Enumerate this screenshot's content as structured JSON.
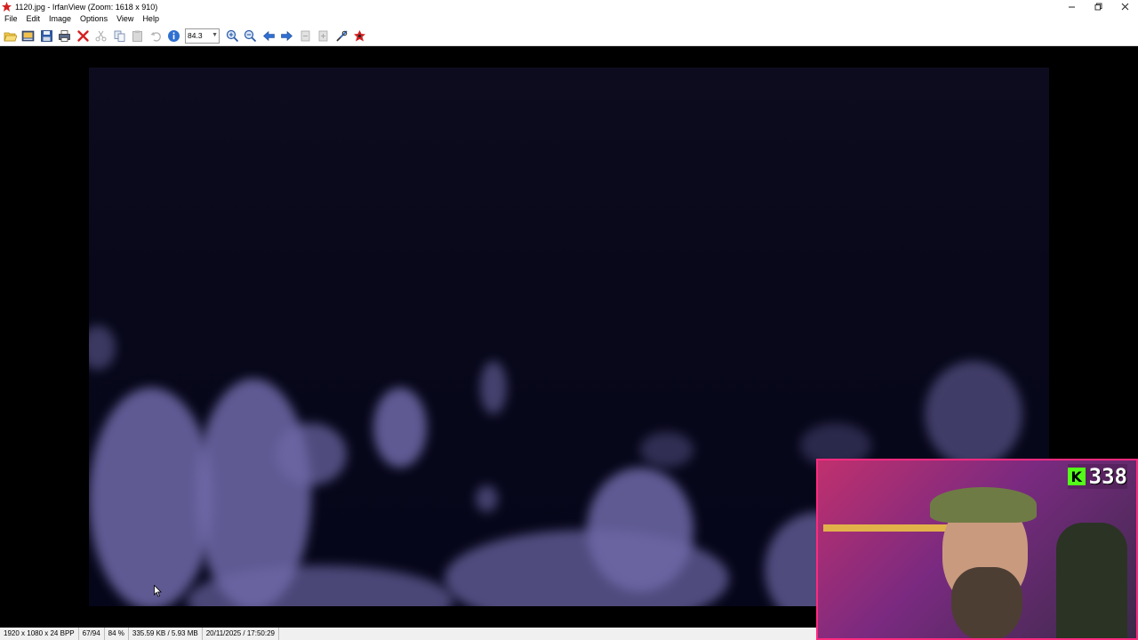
{
  "window": {
    "title": "1120.jpg - IrfanView (Zoom: 1618 x 910)",
    "controls": [
      "minimize",
      "restore",
      "close"
    ]
  },
  "menu": [
    "File",
    "Edit",
    "Image",
    "Options",
    "View",
    "Help"
  ],
  "toolbar": {
    "buttons": [
      {
        "name": "open-icon"
      },
      {
        "name": "slideshow-icon"
      },
      {
        "name": "save-icon"
      },
      {
        "name": "print-icon"
      },
      {
        "name": "delete-icon"
      },
      {
        "name": "cut-icon"
      },
      {
        "name": "copy-icon"
      },
      {
        "name": "paste-icon"
      },
      {
        "name": "undo-icon"
      },
      {
        "name": "info-icon"
      }
    ],
    "zoom_value": "84.3",
    "buttons_after": [
      {
        "name": "zoom-in-icon"
      },
      {
        "name": "zoom-out-icon"
      },
      {
        "name": "previous-icon"
      },
      {
        "name": "next-icon"
      },
      {
        "name": "first-page-icon"
      },
      {
        "name": "last-page-icon"
      },
      {
        "name": "settings-icon"
      },
      {
        "name": "irfanview-logo-icon"
      }
    ]
  },
  "webcam": {
    "viewer_count": "338",
    "badge_letter": "K",
    "accent": "#53fc18"
  },
  "statusbar": {
    "dimensions": "1920 x 1080 x 24 BPP",
    "position": "67/94",
    "zoom": "84 %",
    "size": "335.59 KB / 5.93 MB",
    "datetime": "20/11/2025 / 17:50:29"
  }
}
